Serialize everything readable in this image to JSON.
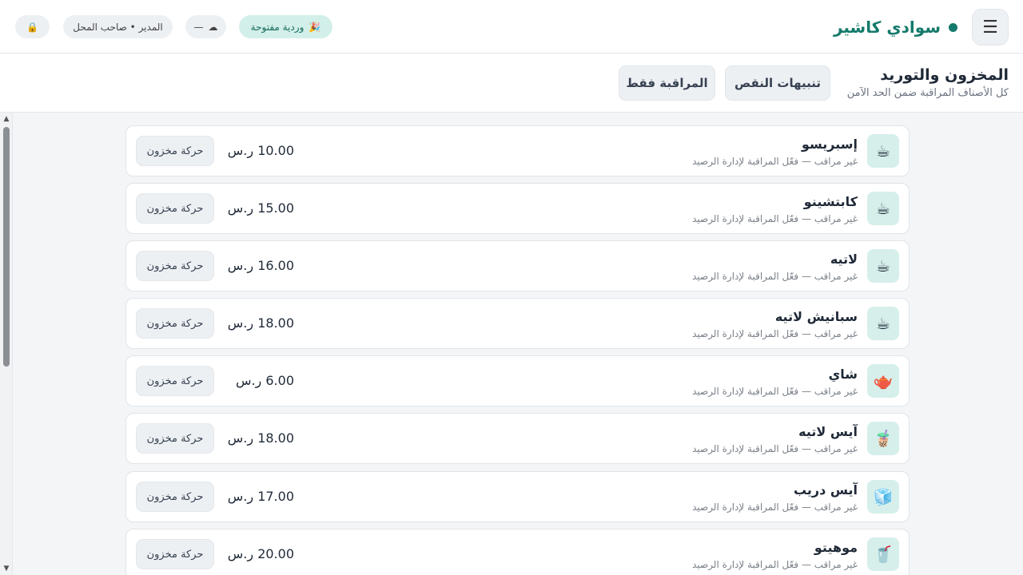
{
  "header": {
    "menu_icon": "☰",
    "brand": "سوادي كاشير",
    "shift_label": "وردية مفتوحة",
    "shift_icon": "🎉",
    "cloud_icon": "☁",
    "cloud_status": "—",
    "role_label": "المدير • صاحب المحل",
    "lock_icon": "🔒"
  },
  "section": {
    "title": "المخزون والتوريد",
    "subtitle": "كل الأصناف المراقبة ضمن الحد الآمن",
    "alerts_button": "تنبيهات النقص",
    "monitored_button": "المراقبة فقط"
  },
  "scrollbar": {
    "up": "▲",
    "down": "▼"
  },
  "items": [
    {
      "name": "إسبريسو",
      "status": "غير مراقب — فعّل المراقبة لإدارة الرصيد",
      "price": "10.00 ر.س",
      "action": "حركة مخزون",
      "icon": "☕"
    },
    {
      "name": "كابتشينو",
      "status": "غير مراقب — فعّل المراقبة لإدارة الرصيد",
      "price": "15.00 ر.س",
      "action": "حركة مخزون",
      "icon": "☕"
    },
    {
      "name": "لاتيه",
      "status": "غير مراقب — فعّل المراقبة لإدارة الرصيد",
      "price": "16.00 ر.س",
      "action": "حركة مخزون",
      "icon": "☕"
    },
    {
      "name": "سبانيش لاتيه",
      "status": "غير مراقب — فعّل المراقبة لإدارة الرصيد",
      "price": "18.00 ر.س",
      "action": "حركة مخزون",
      "icon": "☕"
    },
    {
      "name": "شاي",
      "status": "غير مراقب — فعّل المراقبة لإدارة الرصيد",
      "price": "6.00 ر.س",
      "action": "حركة مخزون",
      "icon": "🫖"
    },
    {
      "name": "آيس لاتيه",
      "status": "غير مراقب — فعّل المراقبة لإدارة الرصيد",
      "price": "18.00 ر.س",
      "action": "حركة مخزون",
      "icon": "🧋"
    },
    {
      "name": "آيس دريب",
      "status": "غير مراقب — فعّل المراقبة لإدارة الرصيد",
      "price": "17.00 ر.س",
      "action": "حركة مخزون",
      "icon": "🧊"
    },
    {
      "name": "موهيتو",
      "status": "غير مراقب — فعّل المراقبة لإدارة الرصيد",
      "price": "20.00 ر.س",
      "action": "حركة مخزون",
      "icon": "🥤"
    }
  ]
}
